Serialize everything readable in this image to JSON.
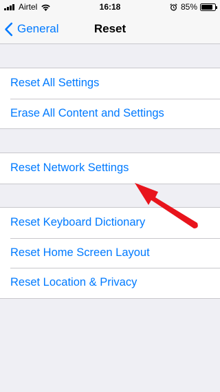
{
  "status_bar": {
    "carrier": "Airtel",
    "time": "16:18",
    "battery_percent": "85%",
    "battery_level": 0.85,
    "icons": [
      "signal-icon",
      "wifi-icon",
      "alarm-icon",
      "battery-icon"
    ]
  },
  "nav": {
    "back_label": "General",
    "title": "Reset"
  },
  "groups": [
    {
      "items": [
        "Reset All Settings",
        "Erase All Content and Settings"
      ]
    },
    {
      "items": [
        "Reset Network Settings"
      ]
    },
    {
      "items": [
        "Reset Keyboard Dictionary",
        "Reset Home Screen Layout",
        "Reset Location & Privacy"
      ]
    }
  ],
  "colors": {
    "link": "#007aff",
    "background": "#efeff4",
    "annotation_arrow": "#e8141c"
  }
}
